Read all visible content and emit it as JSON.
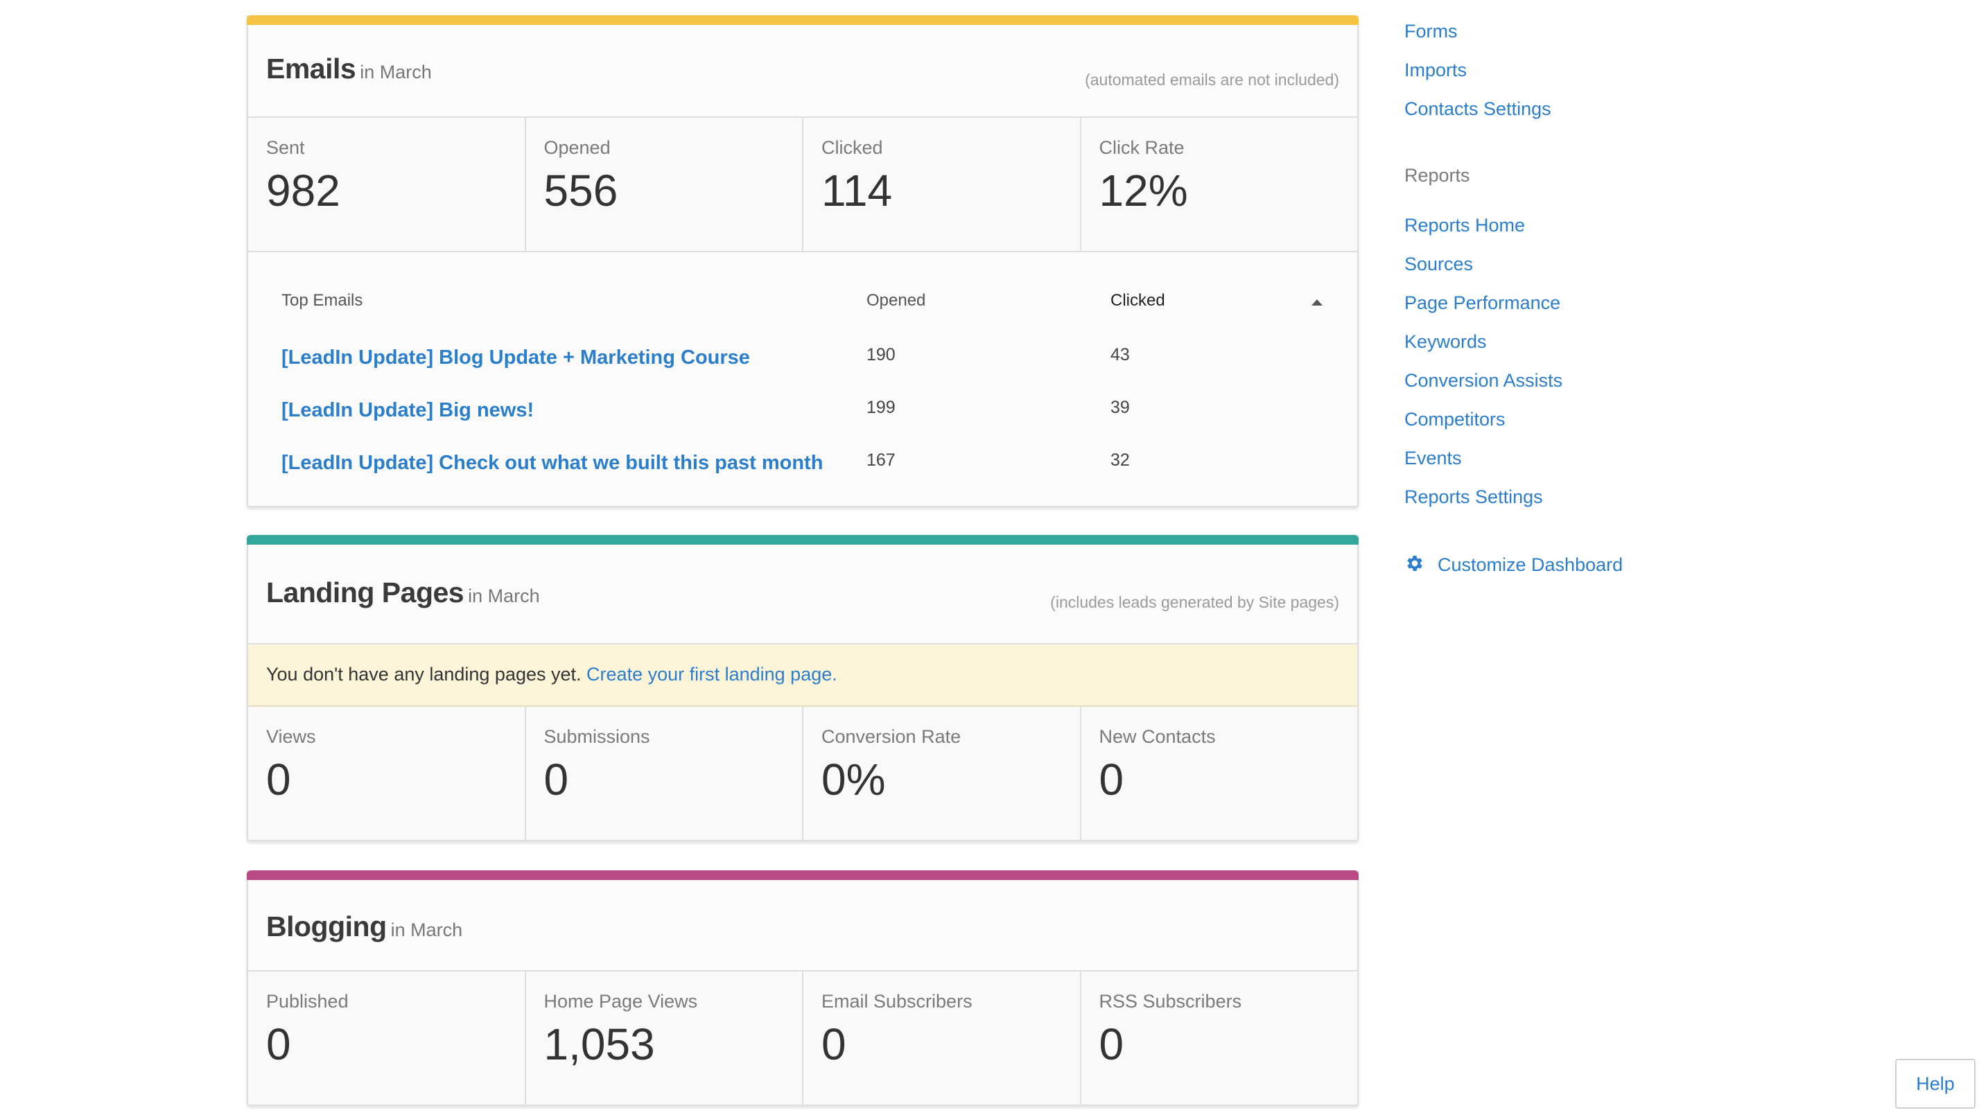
{
  "colors": {
    "emails_bar": "#f5c342",
    "landing_bar": "#33a89a",
    "blogging_bar": "#b94a86",
    "link": "#2a7ecb"
  },
  "emails": {
    "title": "Emails",
    "subtitle": "in March",
    "note": "(automated emails are not included)",
    "stats": [
      {
        "label": "Sent",
        "value": "982"
      },
      {
        "label": "Opened",
        "value": "556"
      },
      {
        "label": "Clicked",
        "value": "114"
      },
      {
        "label": "Click Rate",
        "value": "12%"
      }
    ],
    "table": {
      "headers": [
        "Top Emails",
        "Opened",
        "Clicked"
      ],
      "rows": [
        {
          "name": "[LeadIn Update] Blog Update + Marketing Course",
          "opened": "190",
          "clicked": "43"
        },
        {
          "name": "[LeadIn Update] Big news!",
          "opened": "199",
          "clicked": "39"
        },
        {
          "name": "[LeadIn Update] Check out what we built this past month",
          "opened": "167",
          "clicked": "32"
        }
      ]
    }
  },
  "landing": {
    "title": "Landing Pages",
    "subtitle": "in March",
    "note": "(includes leads generated by Site pages)",
    "alert_text": "You don't have any landing pages yet.",
    "alert_link": "Create your first landing page.",
    "stats": [
      {
        "label": "Views",
        "value": "0"
      },
      {
        "label": "Submissions",
        "value": "0"
      },
      {
        "label": "Conversion Rate",
        "value": "0%"
      },
      {
        "label": "New Contacts",
        "value": "0"
      }
    ]
  },
  "blogging": {
    "title": "Blogging",
    "subtitle": "in March",
    "stats": [
      {
        "label": "Published",
        "value": "0"
      },
      {
        "label": "Home Page Views",
        "value": "1,053"
      },
      {
        "label": "Email Subscribers",
        "value": "0"
      },
      {
        "label": "RSS Subscribers",
        "value": "0"
      }
    ]
  },
  "sidebar": {
    "contacts_links": [
      "Forms",
      "Imports",
      "Contacts Settings"
    ],
    "reports_heading": "Reports",
    "reports_links": [
      "Reports Home",
      "Sources",
      "Page Performance",
      "Keywords",
      "Conversion Assists",
      "Competitors",
      "Events",
      "Reports Settings"
    ],
    "customize_label": "Customize Dashboard",
    "customize_icon": "gear-icon"
  },
  "help_label": "Help"
}
